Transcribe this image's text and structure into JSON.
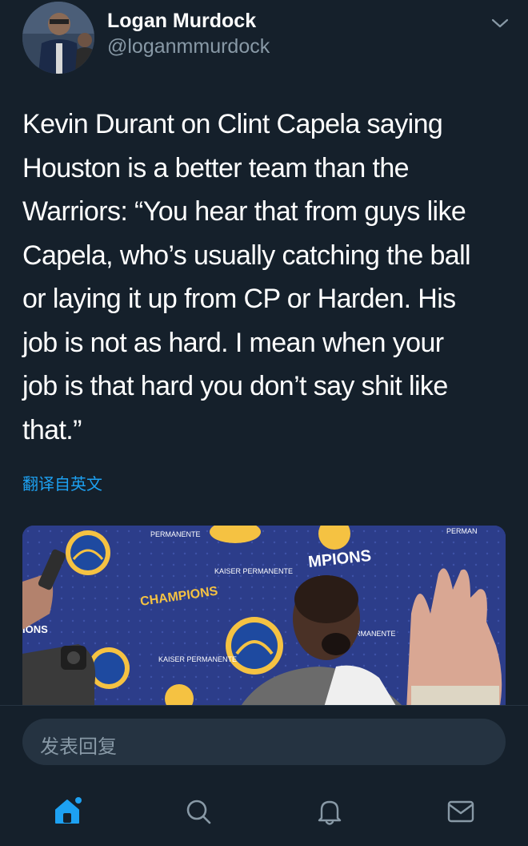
{
  "author": {
    "display_name": "Logan Murdock",
    "handle": "@loganmmurdock"
  },
  "tweet": {
    "text": "Kevin Durant on Clint Capela saying\nHouston is a better team than the\nWarriors: “You hear that from guys like\nCapela, who’s usually catching the ball\nor laying it up from CP or Harden. His\njob is not as hard. I mean when your\njob is that hard you don’t say shit like\nthat.”",
    "translate_label": "翻译自英文"
  },
  "media": {
    "backdrop_texts": [
      "CHAMPIONS",
      "CHAMPIONS",
      "MPIONS",
      "KAISER PERMANENTE",
      "PERMANENTE"
    ]
  },
  "reply": {
    "placeholder": "发表回复"
  },
  "tabbar": {
    "items": [
      "home-icon",
      "search-icon",
      "notifications-icon",
      "messages-icon"
    ]
  },
  "colors": {
    "background": "#15202b",
    "accent": "#1da1f2",
    "secondary_text": "#8899a6",
    "input_bg": "#253341"
  }
}
